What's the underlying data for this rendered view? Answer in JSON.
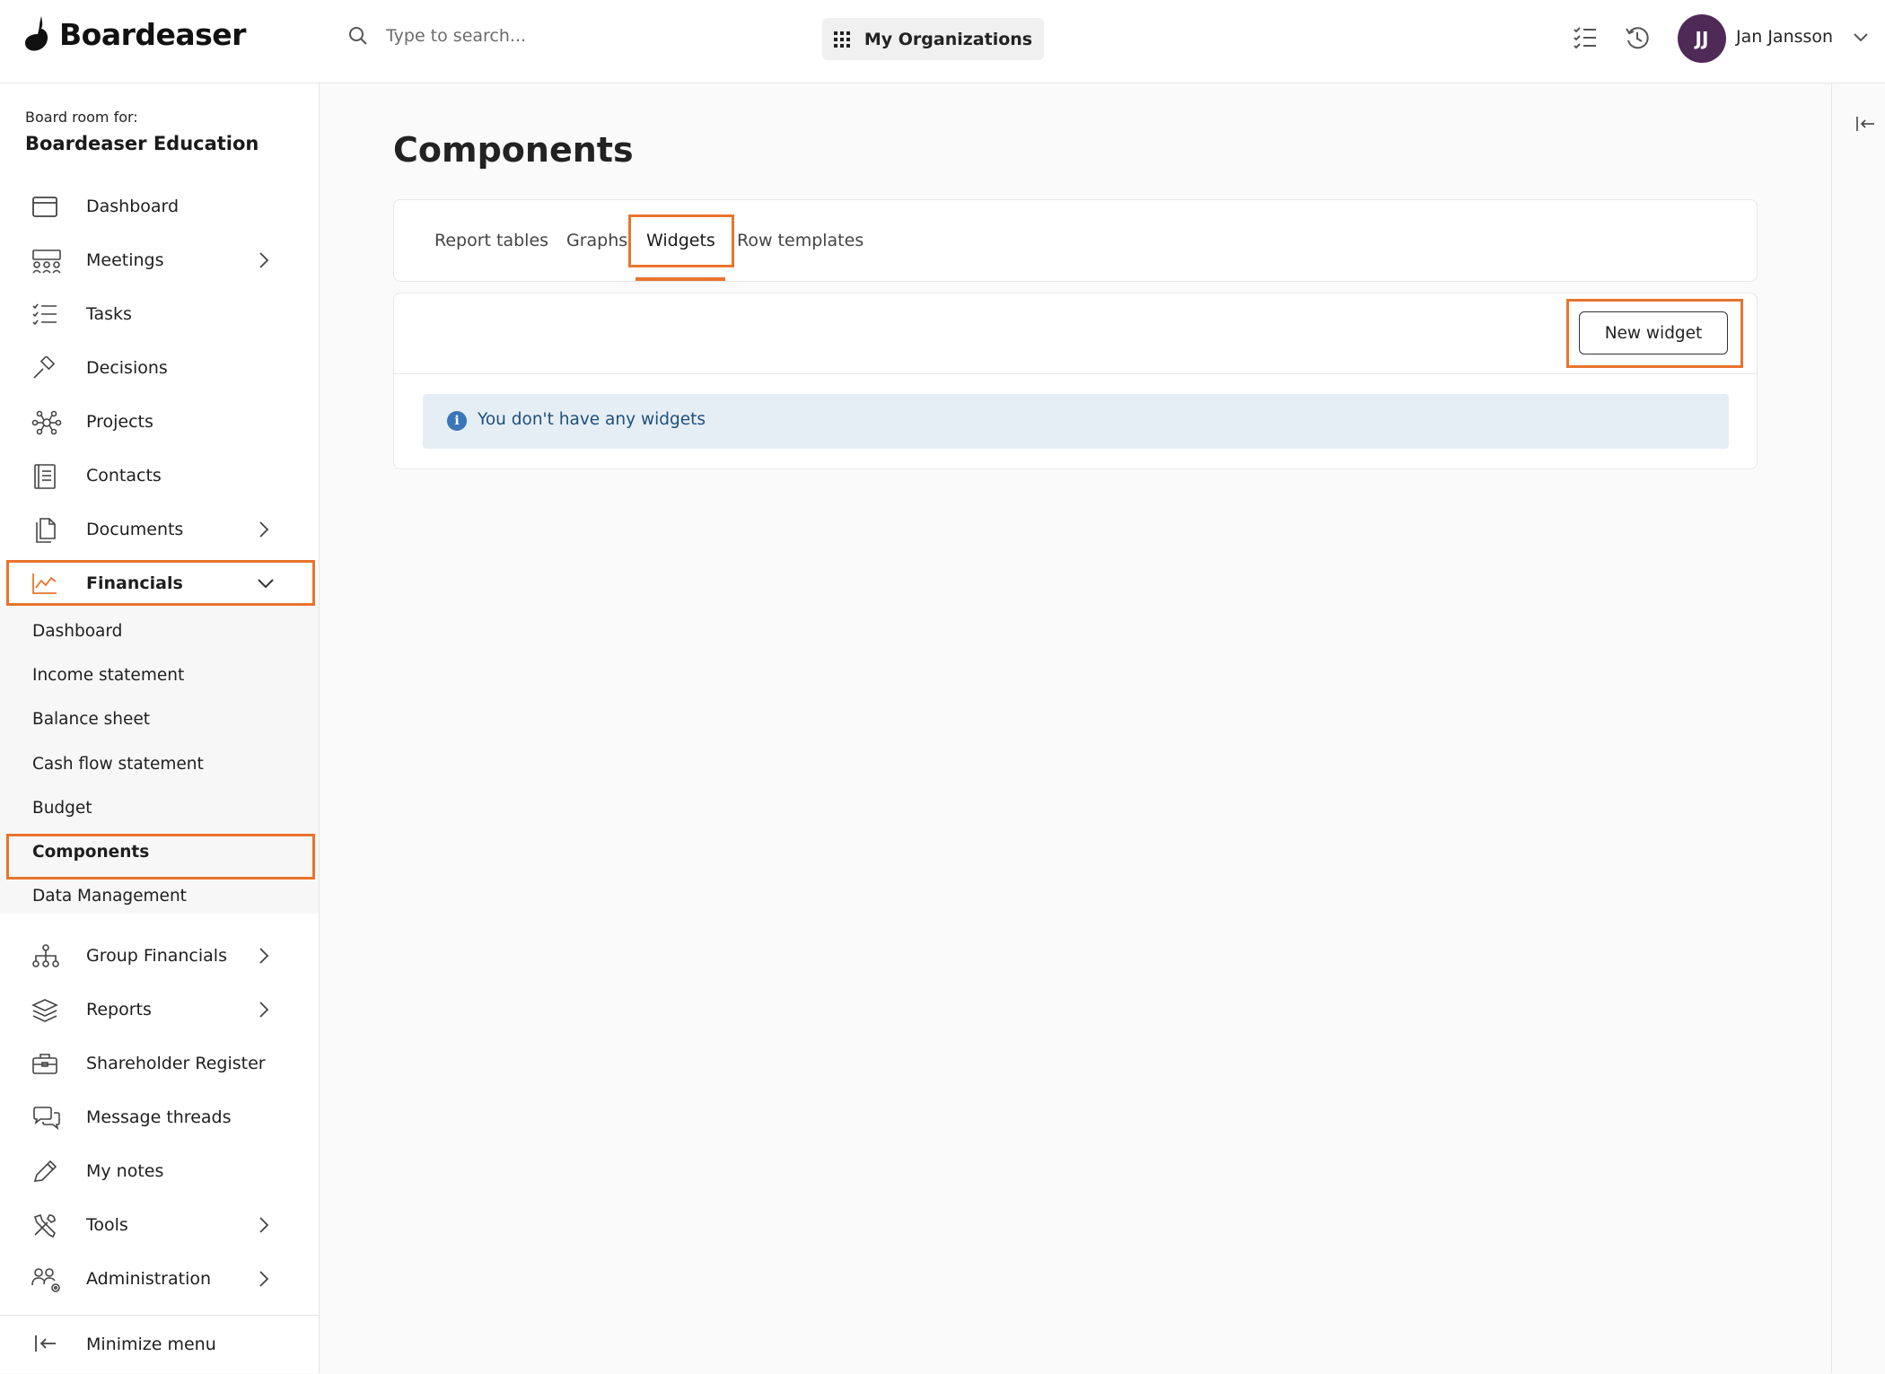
{
  "app": {
    "name": "Boardeaser",
    "brand_color": "#e8742e"
  },
  "search": {
    "placeholder": "Type to search..."
  },
  "header": {
    "org_button_label": "My Organizations"
  },
  "user": {
    "initials": "JJ",
    "name": "Jan Jansson",
    "avatar_color": "#4f2a57"
  },
  "sidebar": {
    "boardroom_label": "Board room for:",
    "boardroom_name": "Boardeaser Education",
    "items": [
      {
        "label": "Dashboard",
        "icon": "calendar-icon"
      },
      {
        "label": "Meetings",
        "icon": "meeting-icon",
        "chevron": true
      },
      {
        "label": "Tasks",
        "icon": "tasks-icon"
      },
      {
        "label": "Decisions",
        "icon": "gavel-icon"
      },
      {
        "label": "Projects",
        "icon": "network-icon"
      },
      {
        "label": "Contacts",
        "icon": "contacts-book-icon"
      },
      {
        "label": "Documents",
        "icon": "documents-icon",
        "chevron": true
      },
      {
        "label": "Financials",
        "icon": "chart-line-icon",
        "expanded": true,
        "active": true
      },
      {
        "label": "Group Financials",
        "icon": "org-chart-icon",
        "chevron": true
      },
      {
        "label": "Reports",
        "icon": "layers-icon",
        "chevron": true
      },
      {
        "label": "Shareholder Register",
        "icon": "briefcase-icon"
      },
      {
        "label": "Message threads",
        "icon": "chat-icon"
      },
      {
        "label": "My notes",
        "icon": "pencil-icon"
      },
      {
        "label": "Tools",
        "icon": "tools-icon",
        "chevron": true
      },
      {
        "label": "Administration",
        "icon": "admin-users-icon",
        "chevron": true
      }
    ],
    "financials_sub": [
      {
        "label": "Dashboard"
      },
      {
        "label": "Income statement"
      },
      {
        "label": "Balance sheet"
      },
      {
        "label": "Cash flow statement"
      },
      {
        "label": "Budget"
      },
      {
        "label": "Components",
        "active": true
      },
      {
        "label": "Data Management"
      }
    ],
    "minimize_label": "Minimize menu"
  },
  "main": {
    "title": "Components",
    "tabs": [
      {
        "label": "Report tables"
      },
      {
        "label": "Graphs"
      },
      {
        "label": "Widgets",
        "active": true
      },
      {
        "label": "Row templates"
      }
    ],
    "new_button_label": "New widget",
    "empty_message": "You don't have any widgets"
  }
}
